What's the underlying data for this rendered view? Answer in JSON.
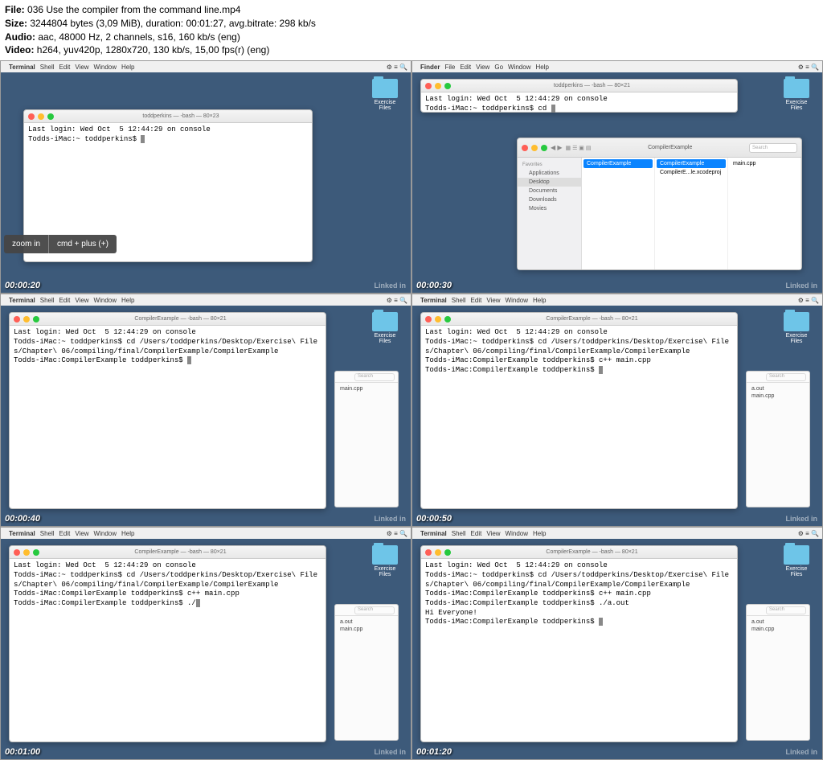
{
  "meta": {
    "file_label": "File:",
    "file_value": "036 Use the compiler from the command line.mp4",
    "size_label": "Size:",
    "size_value": "3244804 bytes (3,09 MiB), duration: 00:01:27, avg.bitrate: 298 kb/s",
    "audio_label": "Audio:",
    "audio_value": "aac, 48000 Hz, 2 channels, s16, 160 kb/s (eng)",
    "video_label": "Video:",
    "video_value": "h264, yuv420p, 1280x720, 130 kb/s, 15,00 fps(r) (eng)"
  },
  "menubar": {
    "apple": "",
    "terminal_app": "Terminal",
    "finder_app": "Finder",
    "items": [
      "Shell",
      "Edit",
      "View",
      "Window",
      "Help"
    ],
    "finder_items": [
      "File",
      "Edit",
      "View",
      "Go",
      "Window",
      "Help"
    ]
  },
  "desktop_folder": "Exercise Files",
  "linkedin": "Linked in",
  "frames": [
    {
      "timestamp": "00:00:20",
      "term_title": "toddperkins — -bash — 80×23",
      "term_lines": "Last login: Wed Oct  5 12:44:29 on console\nTodds-iMac:~ toddperkins$ ",
      "shortcut": {
        "left": "zoom in",
        "right": "cmd + plus (+)"
      }
    },
    {
      "timestamp": "00:00:30",
      "term_title": "toddperkins — -bash — 80×21",
      "term_lines": "Last login: Wed Oct  5 12:44:29 on console\nTodds-iMac:~ toddperkins$ cd ",
      "finder": {
        "title": "CompilerExample",
        "search": "Search",
        "sidebar_group": "Favorites",
        "sidebar": [
          "Applications",
          "Desktop",
          "Documents",
          "Downloads",
          "Movies"
        ],
        "sidebar_selected": "Desktop",
        "col1": [
          {
            "t": "CompilerExample",
            "sel": true
          }
        ],
        "col2": [
          {
            "t": "CompilerExample",
            "sel": true
          },
          {
            "t": "CompilerE...le.xcodeproj",
            "sel": false
          }
        ],
        "col3": [
          {
            "t": "main.cpp",
            "sel": false
          }
        ]
      }
    },
    {
      "timestamp": "00:00:40",
      "term_title": "CompilerExample — -bash — 80×21",
      "term_lines": "Last login: Wed Oct  5 12:44:29 on console\nTodds-iMac:~ toddperkins$ cd /Users/toddperkins/Desktop/Exercise\\ Files/Chapter\\ 06/compiling/final/CompilerExample/CompilerExample\nTodds-iMac:CompilerExample toddperkins$ ",
      "mini_files": [
        "main.cpp"
      ],
      "mini_search": "Search"
    },
    {
      "timestamp": "00:00:50",
      "term_title": "CompilerExample — -bash — 80×21",
      "term_lines": "Last login: Wed Oct  5 12:44:29 on console\nTodds-iMac:~ toddperkins$ cd /Users/toddperkins/Desktop/Exercise\\ Files/Chapter\\ 06/compiling/final/CompilerExample/CompilerExample\nTodds-iMac:CompilerExample toddperkins$ c++ main.cpp\nTodds-iMac:CompilerExample toddperkins$ ",
      "mini_files": [
        "a.out",
        "main.cpp"
      ],
      "mini_search": "Search"
    },
    {
      "timestamp": "00:01:00",
      "term_title": "CompilerExample — -bash — 80×21",
      "term_lines": "Last login: Wed Oct  5 12:44:29 on console\nTodds-iMac:~ toddperkins$ cd /Users/toddperkins/Desktop/Exercise\\ Files/Chapter\\ 06/compiling/final/CompilerExample/CompilerExample\nTodds-iMac:CompilerExample toddperkins$ c++ main.cpp\nTodds-iMac:CompilerExample toddperkins$ ./",
      "mini_files": [
        "a.out",
        "main.cpp"
      ],
      "mini_search": "Search"
    },
    {
      "timestamp": "00:01:20",
      "term_title": "CompilerExample — -bash — 80×21",
      "term_lines": "Last login: Wed Oct  5 12:44:29 on console\nTodds-iMac:~ toddperkins$ cd /Users/toddperkins/Desktop/Exercise\\ Files/Chapter\\ 06/compiling/final/CompilerExample/CompilerExample\nTodds-iMac:CompilerExample toddperkins$ c++ main.cpp\nTodds-iMac:CompilerExample toddperkins$ ./a.out\nHi Everyone!\nTodds-iMac:CompilerExample toddperkins$ ",
      "mini_files": [
        "a.out",
        "main.cpp"
      ],
      "mini_search": "Search"
    }
  ]
}
